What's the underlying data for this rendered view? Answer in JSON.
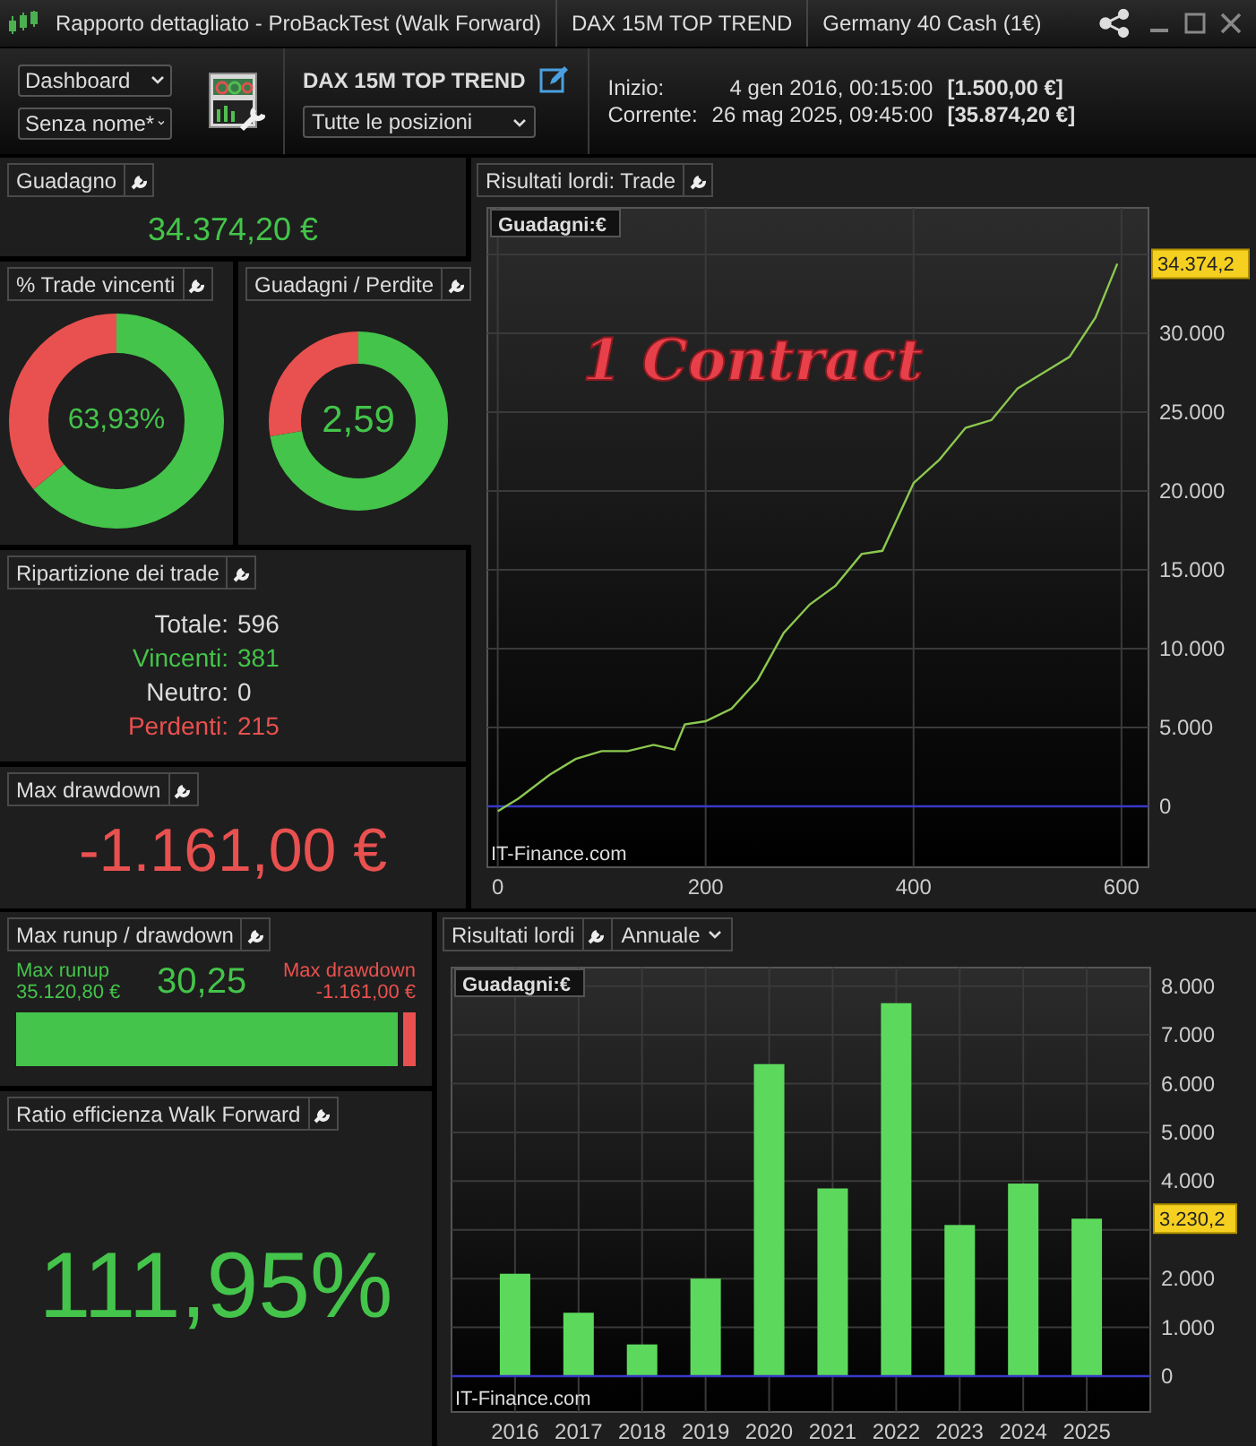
{
  "window": {
    "title": "Rapporto dettagliato - ProBackTest (Walk Forward)",
    "segments": [
      "DAX 15M TOP TREND",
      "Germany 40 Cash (1€)"
    ]
  },
  "toolbar": {
    "view_select": "Dashboard",
    "layout_select": "Senza nome*",
    "strategy_name": "DAX 15M TOP TREND",
    "positions_select": "Tutte le posizioni",
    "start": {
      "label": "Inizio:",
      "date": "4 gen 2016, 00:15:00",
      "amount": "[1.500,00 €]"
    },
    "current": {
      "label": "Corrente:",
      "date": "26 mag 2025, 09:45:00",
      "amount": "[35.874,20 €]"
    }
  },
  "gain": {
    "title": "Guadagno",
    "value": "34.374,20 €"
  },
  "win_rate": {
    "title": "% Trade vincenti",
    "value": "63,93%",
    "level": 0.6393
  },
  "profit_loss": {
    "title": "Guadagni / Perdite",
    "value": "2,59",
    "level": 0.7214
  },
  "breakdown": {
    "title": "Ripartizione dei trade",
    "rows": [
      {
        "label": "Totale:",
        "value": "596",
        "color": "#dcdcdc"
      },
      {
        "label": "Vincenti:",
        "value": "381",
        "color": "#44c44a"
      },
      {
        "label": "Neutro:",
        "value": "0",
        "color": "#dcdcdc"
      },
      {
        "label": "Perdenti:",
        "value": "215",
        "color": "#e8514f"
      }
    ]
  },
  "max_drawdown": {
    "title": "Max drawdown",
    "value": "-1.161,00 €"
  },
  "runup": {
    "title": "Max runup / drawdown",
    "runup_label": "Max runup",
    "runup_value": "35.120,80 €",
    "ratio": "30,25",
    "drawdown_label": "Max drawdown",
    "drawdown_value": "-1.161,00 €",
    "level": 0.968
  },
  "wf_efficiency": {
    "title": "Ratio efficienza Walk Forward",
    "value": "111,95%"
  },
  "trade_chart": {
    "title": "Risultati lordi: Trade",
    "last_value": "34.374,2",
    "source": "IT-Finance.com",
    "chart_data": {
      "type": "line",
      "x": [
        0,
        20,
        50,
        75,
        100,
        125,
        150,
        170,
        180,
        200,
        225,
        250,
        275,
        300,
        325,
        350,
        370,
        400,
        425,
        450,
        475,
        500,
        525,
        550,
        575,
        596
      ],
      "series": [
        {
          "name": "Guadagni:€",
          "color": "#8cc850",
          "values": [
            -300,
            500,
            2000,
            3000,
            3500,
            3500,
            3900,
            3600,
            5200,
            5400,
            6200,
            8000,
            11000,
            12800,
            14000,
            16000,
            16200,
            20500,
            22000,
            24000,
            24500,
            26500,
            27500,
            28500,
            31000,
            34400
          ]
        }
      ],
      "grid": true,
      "ref_lines": [
        {
          "axis": "y",
          "value": 0,
          "color": "#3838c8"
        }
      ],
      "xlim": [
        -10,
        626
      ],
      "ylim": [
        -3860,
        37950
      ],
      "xticks": [
        0,
        200,
        400,
        600
      ],
      "yticks": [
        {
          "value": 0,
          "label": "0"
        },
        {
          "value": 5000,
          "label": "5.000"
        },
        {
          "value": 10000,
          "label": "10.000"
        },
        {
          "value": 15000,
          "label": "15.000"
        },
        {
          "value": 20000,
          "label": "20.000"
        },
        {
          "value": 25000,
          "label": "25.000"
        },
        {
          "value": 30000,
          "label": "30.000"
        }
      ],
      "annotations": [
        {
          "text": "1 Contract"
        }
      ]
    }
  },
  "yearly_chart": {
    "title": "Risultati lordi",
    "period_select": "Annuale",
    "last_value": "3.230,2",
    "source": "IT-Finance.com",
    "chart_data": {
      "type": "bar",
      "categories": [
        "2016",
        "2017",
        "2018",
        "2019",
        "2020",
        "2021",
        "2022",
        "2023",
        "2024",
        "2025"
      ],
      "series": [
        {
          "name": "Guadagni:€",
          "color": "#5cd95c",
          "values": [
            2100,
            1300,
            650,
            2000,
            6400,
            3850,
            7650,
            3100,
            3950,
            3230
          ]
        }
      ],
      "grid": true,
      "ref_lines": [
        {
          "axis": "y",
          "value": 0,
          "color": "#3838c8"
        }
      ],
      "ylim": [
        -735,
        8380
      ],
      "yticks": [
        {
          "value": 0,
          "label": "0"
        },
        {
          "value": 1000,
          "label": "1.000"
        },
        {
          "value": 2000,
          "label": "2.000"
        },
        {
          "value": 4000,
          "label": "4.000"
        },
        {
          "value": 5000,
          "label": "5.000"
        },
        {
          "value": 6000,
          "label": "6.000"
        },
        {
          "value": 7000,
          "label": "7.000"
        },
        {
          "value": 8000,
          "label": "8.000"
        }
      ]
    }
  }
}
